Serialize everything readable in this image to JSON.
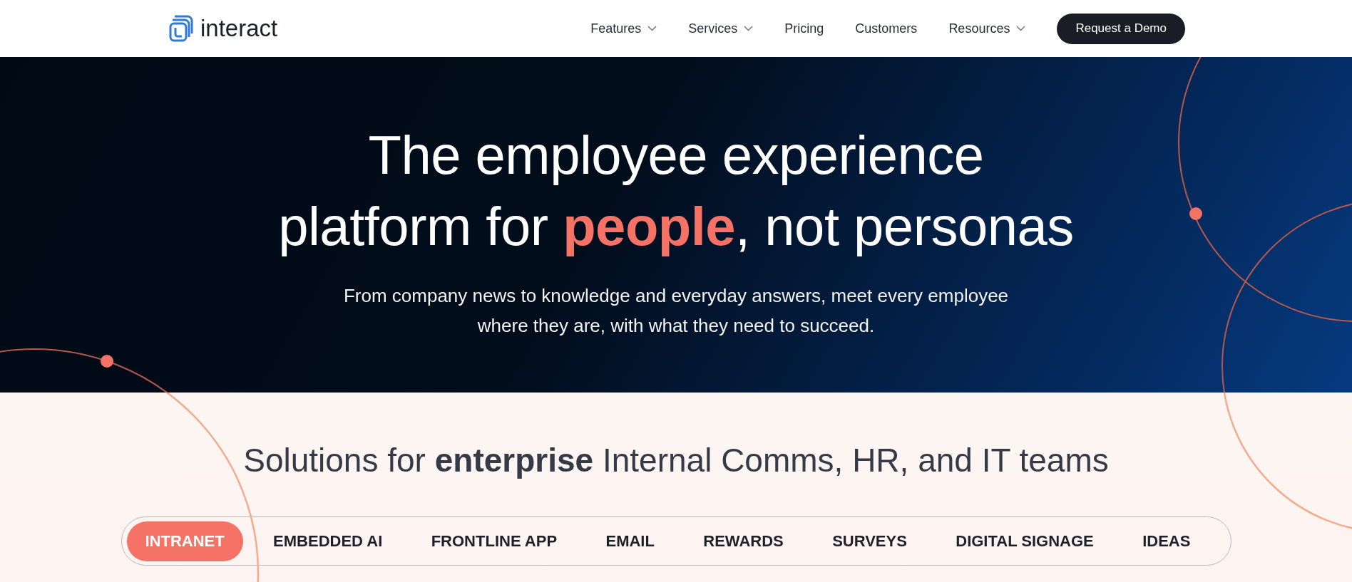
{
  "header": {
    "logo": "interact",
    "nav": [
      {
        "label": "Features",
        "has_dropdown": true
      },
      {
        "label": "Services",
        "has_dropdown": true
      },
      {
        "label": "Pricing",
        "has_dropdown": false
      },
      {
        "label": "Customers",
        "has_dropdown": false
      },
      {
        "label": "Resources",
        "has_dropdown": true
      }
    ],
    "cta": "Request a Demo"
  },
  "hero": {
    "headline": "The employee experience platform for **people**, not personas",
    "subtitle": "From company news to knowledge and everyday answers, meet every employee where they are, with what they need to succeed."
  },
  "solutions": {
    "heading": "Solutions for **enterprise** Internal Comms, HR, and IT teams",
    "tabs": [
      {
        "label": "INTRANET",
        "selected": true
      },
      {
        "label": "EMBEDDED AI",
        "selected": false
      },
      {
        "label": "FRONTLINE APP",
        "selected": false
      },
      {
        "label": "EMAIL",
        "selected": false
      },
      {
        "label": "REWARDS",
        "selected": false
      },
      {
        "label": "SURVEYS",
        "selected": false
      },
      {
        "label": "DIGITAL SIGNAGE",
        "selected": false
      },
      {
        "label": "IDEAS",
        "selected": false
      }
    ]
  }
}
